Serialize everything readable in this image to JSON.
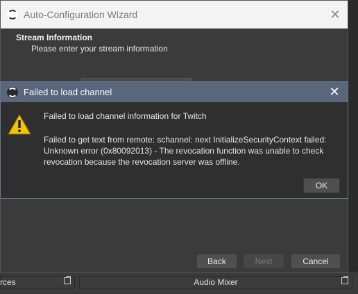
{
  "wizard": {
    "title": "Auto-Configuration Wizard",
    "close_glyph": "✕",
    "heading": "Stream Information",
    "subheading": "Please enter your stream information",
    "buttons": {
      "back": "Back",
      "next": "Next",
      "cancel": "Cancel"
    }
  },
  "dialog": {
    "title": "Failed to load channel",
    "close_glyph": "✕",
    "icon": "warning-icon",
    "message": "Failed to load channel information for Twitch",
    "detail": "Failed to get text from remote: schannel: next InitializeSecurityContext failed: Unknown error (0x80092013) - The revocation function was unable to check revocation because the revocation server was offline.",
    "ok_label": "OK"
  },
  "docks": {
    "sources_label": "rces",
    "mixer_label": "Audio Mixer"
  },
  "colors": {
    "dialog_titlebar": "#58677c",
    "warning_yellow": "#f5c400"
  }
}
